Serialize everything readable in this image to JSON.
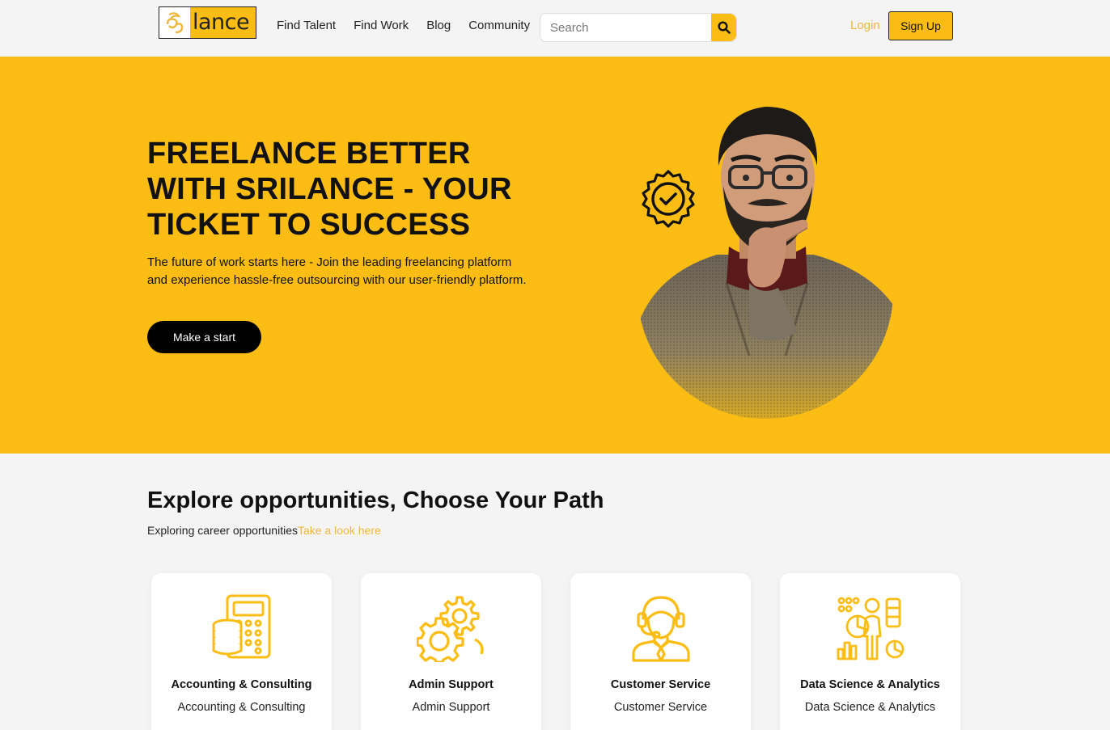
{
  "header": {
    "logo_text": "lance",
    "logo_mark": "ශ්‍රී",
    "nav": [
      "Find Talent",
      "Find Work",
      "Blog",
      "Community"
    ],
    "search_placeholder": "Search",
    "search_icon": "search-icon",
    "login_label": "Login",
    "signup_label": "Sign Up"
  },
  "hero": {
    "title_lines": [
      "FREELANCE BETTER",
      "WITH SRILANCE - YOUR",
      "TICKET TO SUCCESS"
    ],
    "subtitle_line1": "The future of work starts here - Join the leading freelancing platform",
    "subtitle_line2": "and experience hassle-free outsourcing with our user-friendly platform.",
    "cta_label": "Make a start",
    "badge_icon": "verified-badge-icon"
  },
  "explore": {
    "title": "Explore opportunities, Choose Your Path",
    "subtitle": "Exploring career opportunities",
    "link_label": "Take a look here",
    "cards": [
      {
        "title": "Accounting & Consulting",
        "subtitle": "Accounting & Consulting",
        "icon": "calculator-coins-icon"
      },
      {
        "title": "Admin Support",
        "subtitle": "Admin Support",
        "icon": "gears-icon"
      },
      {
        "title": "Customer Service",
        "subtitle": "Customer Service",
        "icon": "headset-agent-icon"
      },
      {
        "title": "Data Science & Analytics",
        "subtitle": "Data Science & Analytics",
        "icon": "data-analytics-icon"
      }
    ]
  },
  "colors": {
    "brand_yellow": "#fbbd14",
    "link_gold": "#f0b73c",
    "button_black": "#000000",
    "page_background": "#f4f4f4"
  }
}
